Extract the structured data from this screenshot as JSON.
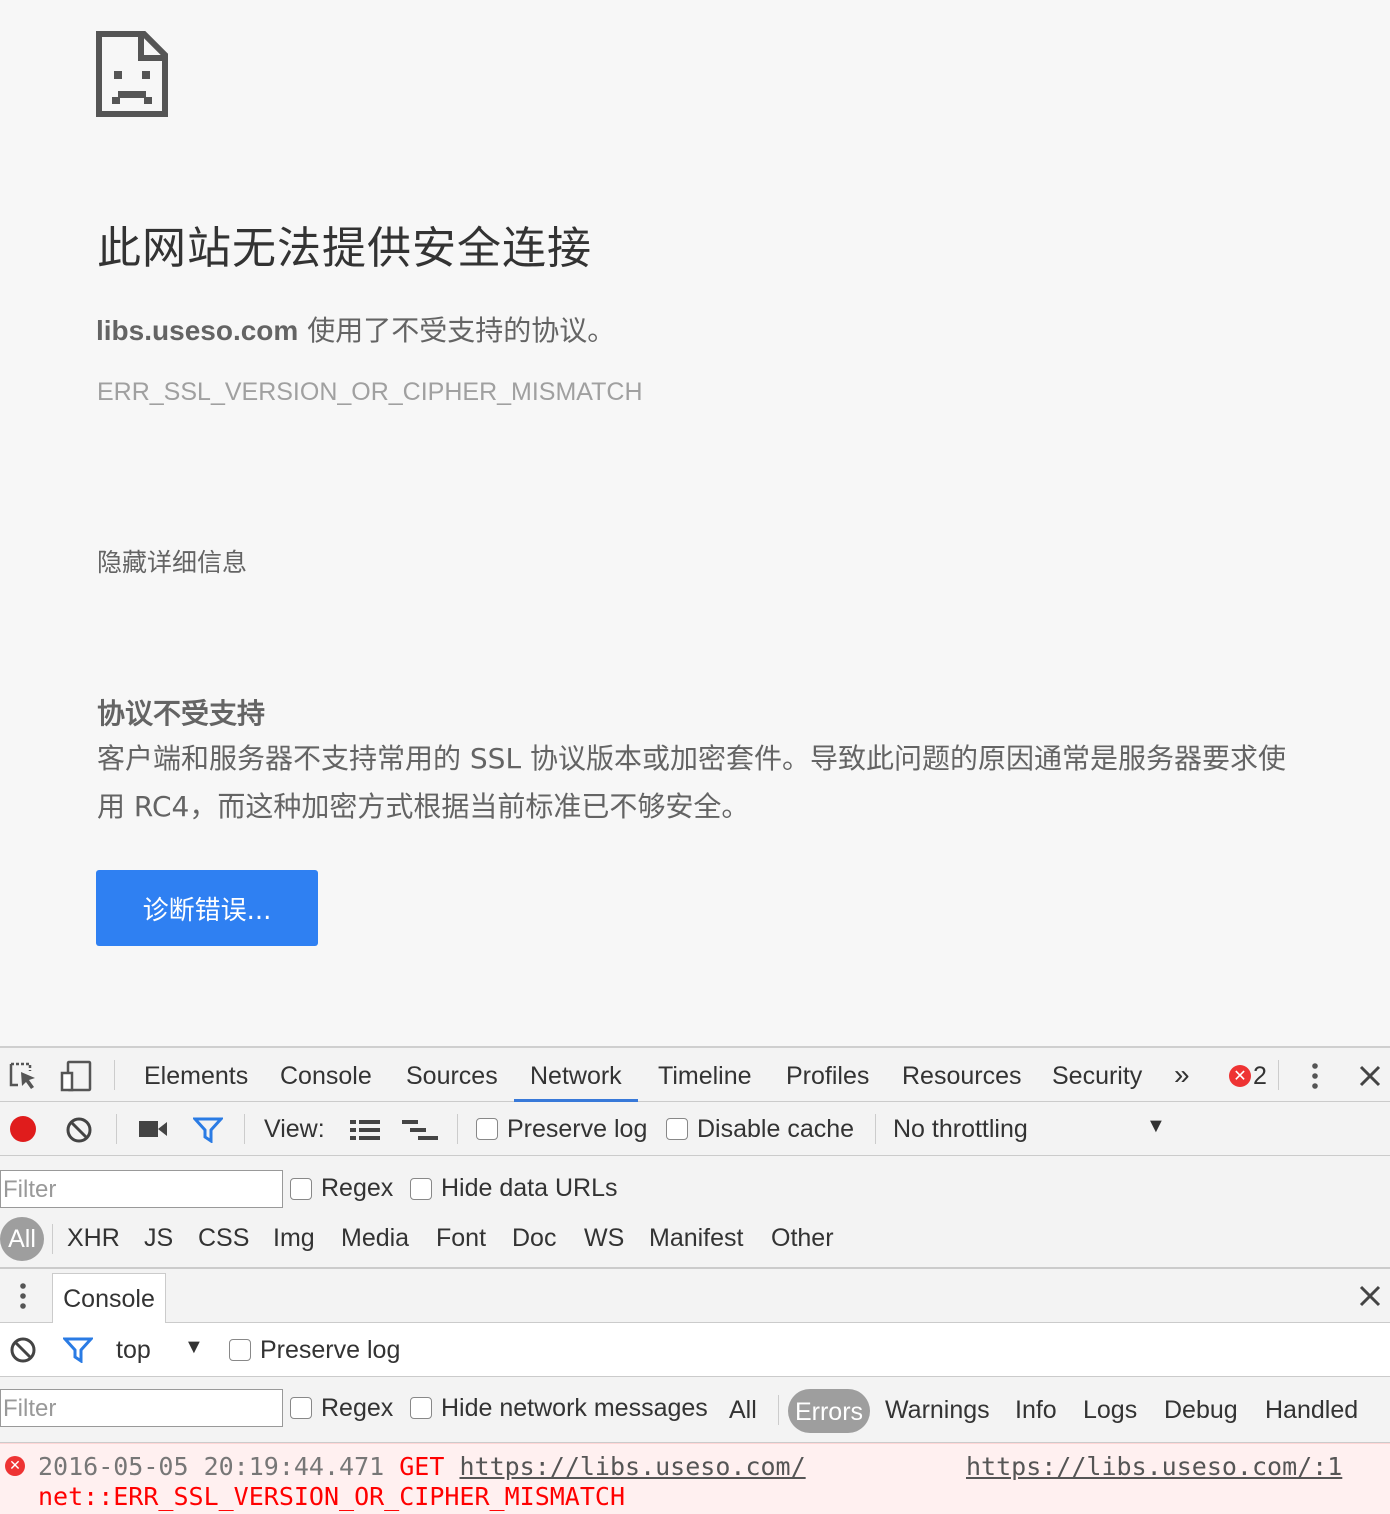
{
  "error_page": {
    "title": "此网站无法提供安全连接",
    "host": "libs.useso.com",
    "description": " 使用了不受支持的协议。",
    "error_code": "ERR_SSL_VERSION_OR_CIPHER_MISMATCH",
    "hide_details": "隐藏详细信息",
    "reason_title": "协议不受支持",
    "reason_body": "客户端和服务器不支持常用的 SSL 协议版本或加密套件。导致此问题的原因通常是服务器要求使用 RC4，而这种加密方式根据当前标准已不够安全。",
    "diagnose_button": "诊断错误..."
  },
  "devtools": {
    "tabs": [
      "Elements",
      "Console",
      "Sources",
      "Network",
      "Timeline",
      "Profiles",
      "Resources",
      "Security"
    ],
    "active_tab": "Network",
    "more_tabs": "»",
    "error_count": "2",
    "network_toolbar": {
      "view_label": "View:",
      "preserve_log": "Preserve log",
      "disable_cache": "Disable cache",
      "throttling": "No throttling"
    },
    "network_filter": {
      "placeholder": "Filter",
      "regex": "Regex",
      "hide_data_urls": "Hide data URLs",
      "types": [
        "All",
        "XHR",
        "JS",
        "CSS",
        "Img",
        "Media",
        "Font",
        "Doc",
        "WS",
        "Manifest",
        "Other"
      ]
    },
    "console_drawer": {
      "tab_label": "Console",
      "context": "top",
      "preserve_log": "Preserve log",
      "filter_placeholder": "Filter",
      "regex": "Regex",
      "hide_network": "Hide network messages",
      "levels": [
        "All",
        "Errors",
        "Warnings",
        "Info",
        "Logs",
        "Debug",
        "Handled"
      ],
      "active_level": "Errors"
    },
    "console_message": {
      "timestamp": "2016-05-05 20:19:44.471",
      "method": "GET",
      "url": "https://libs.useso.com/",
      "source": "https://libs.useso.com/:1",
      "error": "net::ERR_SSL_VERSION_OR_CIPHER_MISMATCH"
    }
  },
  "colors": {
    "button_blue": "#2f80f2",
    "active_tab_underline": "#3879d9",
    "record_red": "#e01c1c",
    "error_red": "#ff0000"
  }
}
